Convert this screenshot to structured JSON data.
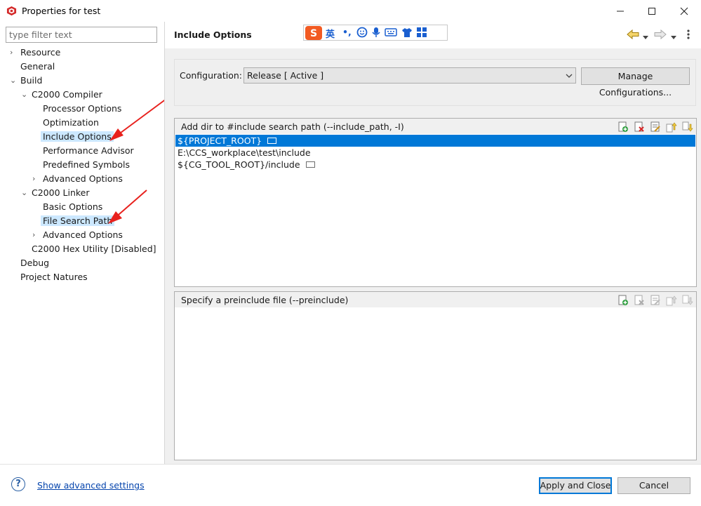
{
  "window": {
    "title": "Properties for test",
    "controls": [
      "minimize",
      "maximize",
      "close"
    ]
  },
  "filter": {
    "placeholder": "type filter text",
    "value": ""
  },
  "tree": {
    "resource": "Resource",
    "general": "General",
    "build": "Build",
    "c2000_compiler": "C2000 Compiler",
    "processor_options": "Processor Options",
    "optimization": "Optimization",
    "include_options": "Include Options",
    "performance_advisor": "Performance Advisor",
    "predefined_symbols": "Predefined Symbols",
    "compiler_advanced_options": "Advanced Options",
    "c2000_linker": "C2000 Linker",
    "basic_options": "Basic Options",
    "file_search_path": "File Search Path",
    "linker_advanced_options": "Advanced Options",
    "hex_utility": "C2000 Hex Utility  [Disabled]",
    "debug": "Debug",
    "project_natures": "Project Natures",
    "selected": "Include Options"
  },
  "page": {
    "title": "Include Options",
    "nav_icons": [
      "back-arrow-icon",
      "back-menu-icon",
      "forward-arrow-icon",
      "forward-menu-icon",
      "view-menu-icon"
    ]
  },
  "ime_toolbar": {
    "mode_label": "英",
    "icons": [
      "sogou-logo-icon",
      "punctuation-icon",
      "emoji-icon",
      "microphone-icon",
      "keyboard-icon",
      "skin-icon",
      "toolbox-icon"
    ]
  },
  "configuration": {
    "label": "Configuration:",
    "selected": "Release  [ Active ]",
    "manage_button": "Manage Configurations..."
  },
  "include_paths": {
    "header": "Add dir to #include search path (--include_path, -I)",
    "rows": [
      "${PROJECT_ROOT}",
      "E:\\CCS_workplace\\test\\include",
      "${CG_TOOL_ROOT}/include"
    ],
    "selected_index": 0,
    "toolbar_icons": [
      "add-icon",
      "delete-icon",
      "edit-icon",
      "move-up-icon",
      "move-down-icon"
    ]
  },
  "preinclude": {
    "header": "Specify a preinclude file (--preinclude)",
    "rows": [],
    "toolbar_icons": [
      "add-icon",
      "delete-icon",
      "edit-icon",
      "move-up-icon",
      "move-down-icon"
    ]
  },
  "footer": {
    "help_symbol": "?",
    "advanced_link": "Show advanced settings",
    "apply_close": "Apply and Close",
    "cancel": "Cancel"
  },
  "colors": {
    "selection": "#0078d7",
    "tree_selection": "#cce8ff",
    "annotation_arrow": "#e8211d",
    "link": "#0645ad"
  }
}
